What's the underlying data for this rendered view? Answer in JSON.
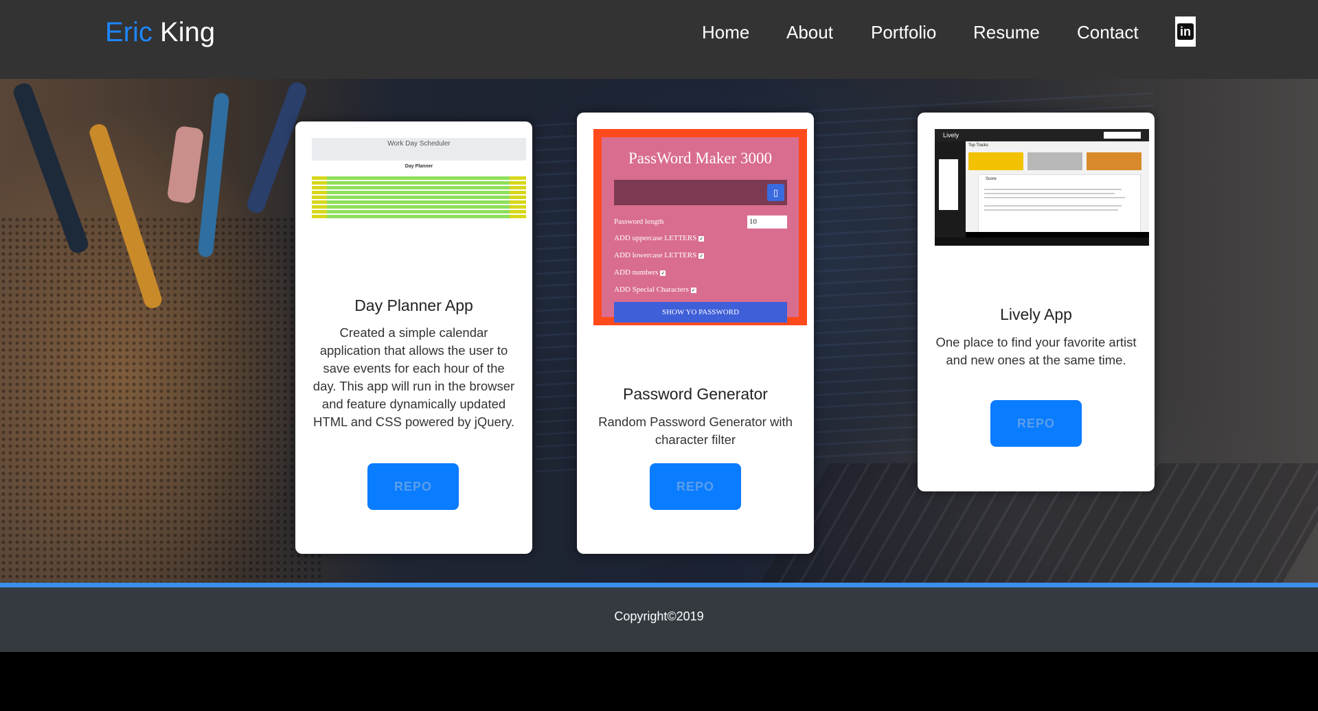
{
  "header": {
    "brand_first": "Eric",
    "brand_last": "King",
    "nav": [
      "Home",
      "About",
      "Portfolio",
      "Resume",
      "Contact"
    ],
    "linkedin_icon": "linkedin-icon"
  },
  "cards": [
    {
      "title": "Day Planner App",
      "description": "Created a simple calendar application that allows the user to save events for each hour of the day. This app will run in the browser and feature dynamically updated HTML and CSS powered by jQuery.",
      "button": "REPO",
      "thumb": {
        "heading": "Work Day Scheduler",
        "subheading": "Day Planner"
      }
    },
    {
      "title": "Password Generator",
      "description": "Random Password Generator with character filter",
      "button": "REPO",
      "thumb": {
        "heading": "PassWord Maker 3000",
        "length_label": "Password length",
        "length_value": "10",
        "options": [
          "ADD uppercase LETTERS",
          "ADD lowercase LETTERS",
          "ADD numbers",
          "ADD Special Characters"
        ],
        "show_button": "SHOW YO PASSWORD"
      }
    },
    {
      "title": "Lively App",
      "description": "One place to find your favorite artist and new ones at the same time.",
      "button": "REPO",
      "thumb": {
        "app_name": "Lively",
        "section": "Top Tracks",
        "subsection": "Score"
      }
    }
  ],
  "footer": {
    "copyright": "Copyright©2019"
  },
  "colors": {
    "brand_accent": "#1e86ff",
    "header_bg": "#333333",
    "footer_bg": "#343a40",
    "stripe": "#3b8eea",
    "button": "#0a7cff"
  }
}
